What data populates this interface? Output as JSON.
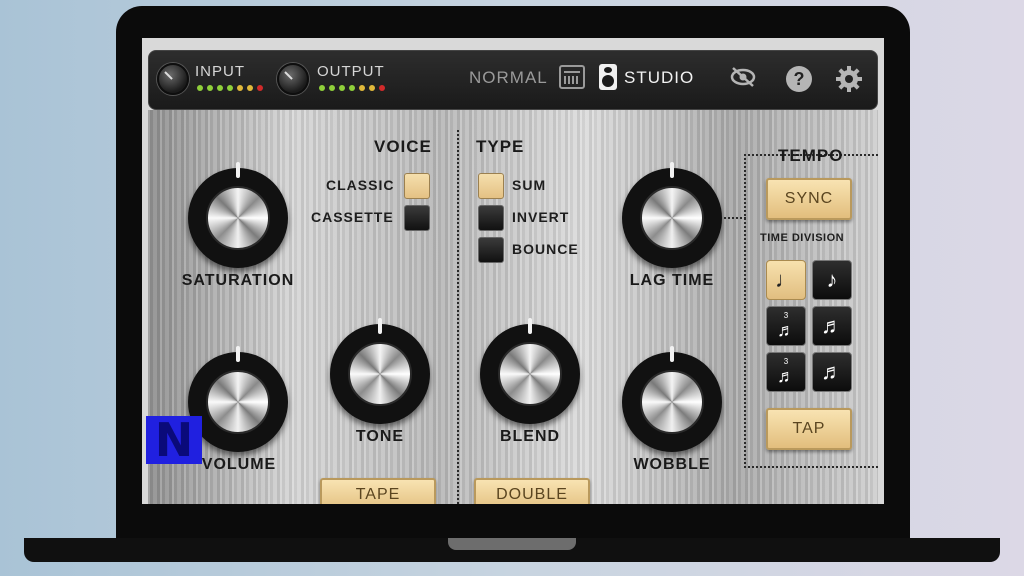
{
  "topbar": {
    "input_label": "INPUT",
    "output_label": "OUTPUT",
    "mode_normal": "NORMAL",
    "mode_studio": "STUDIO",
    "input_leds": [
      "#8fcf3a",
      "#8fcf3a",
      "#8fcf3a",
      "#8fcf3a",
      "#e0b83a",
      "#e0b83a",
      "#d12a2a"
    ],
    "output_leds": [
      "#8fcf3a",
      "#8fcf3a",
      "#8fcf3a",
      "#8fcf3a",
      "#e0b83a",
      "#e0b83a",
      "#d12a2a"
    ],
    "icons": [
      "hide-eye-icon",
      "help-icon",
      "settings-gear-icon"
    ]
  },
  "voice": {
    "title": "VOICE",
    "options": [
      {
        "label": "CLASSIC",
        "selected": true
      },
      {
        "label": "CASSETTE",
        "selected": false
      }
    ]
  },
  "type": {
    "title": "TYPE",
    "options": [
      {
        "label": "SUM",
        "selected": true
      },
      {
        "label": "INVERT",
        "selected": false
      },
      {
        "label": "BOUNCE",
        "selected": false
      }
    ]
  },
  "knobs": {
    "saturation": "SATURATION",
    "volume": "VOLUME",
    "tone": "TONE",
    "blend": "BLEND",
    "lag_time": "LAG TIME",
    "wobble": "WOBBLE"
  },
  "tempo": {
    "title": "TEMPO",
    "sync_label": "SYNC",
    "time_division_label": "TIME DIVISION",
    "tap_label": "TAP",
    "divisions": [
      {
        "glyph": "♩",
        "selected": true
      },
      {
        "glyph": "♪",
        "selected": false
      },
      {
        "glyph": "♬",
        "selected": false
      },
      {
        "glyph": "♬",
        "selected": false
      },
      {
        "glyph": "♬",
        "selected": false
      },
      {
        "glyph": "♬",
        "selected": false
      }
    ],
    "triplet_mark": "3"
  },
  "bottom_buttons": {
    "tape": "TAPE",
    "double": "DOUBLE"
  },
  "logo": "N"
}
